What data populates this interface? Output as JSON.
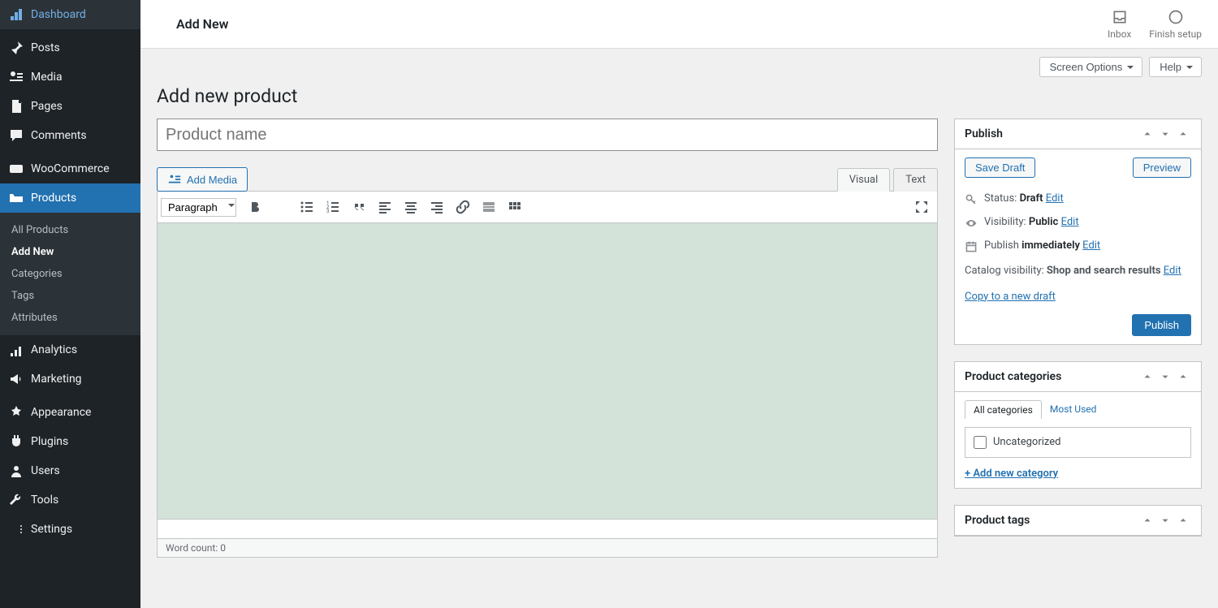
{
  "sidebar": {
    "items": [
      {
        "label": "Dashboard",
        "icon": "dashboard"
      },
      {
        "label": "Posts",
        "icon": "pin"
      },
      {
        "label": "Media",
        "icon": "media"
      },
      {
        "label": "Pages",
        "icon": "pages"
      },
      {
        "label": "Comments",
        "icon": "comments"
      },
      {
        "label": "WooCommerce",
        "icon": "woo"
      },
      {
        "label": "Products",
        "icon": "products",
        "active": true
      },
      {
        "label": "Analytics",
        "icon": "analytics"
      },
      {
        "label": "Marketing",
        "icon": "marketing"
      },
      {
        "label": "Appearance",
        "icon": "appearance"
      },
      {
        "label": "Plugins",
        "icon": "plugins"
      },
      {
        "label": "Users",
        "icon": "users"
      },
      {
        "label": "Tools",
        "icon": "tools"
      },
      {
        "label": "Settings",
        "icon": "settings"
      }
    ],
    "submenu": [
      {
        "label": "All Products"
      },
      {
        "label": "Add New",
        "current": true
      },
      {
        "label": "Categories"
      },
      {
        "label": "Tags"
      },
      {
        "label": "Attributes"
      }
    ]
  },
  "topbar": {
    "title": "Add New",
    "inbox": "Inbox",
    "finish_setup": "Finish setup"
  },
  "page": {
    "screen_options": "Screen Options",
    "help": "Help",
    "title": "Add new product",
    "product_name_placeholder": "Product name"
  },
  "editor": {
    "add_media": "Add Media",
    "tab_visual": "Visual",
    "tab_text": "Text",
    "format": "Paragraph",
    "word_count_label": "Word count:",
    "word_count": "0"
  },
  "publish": {
    "title": "Publish",
    "save_draft": "Save Draft",
    "preview": "Preview",
    "status_label": "Status:",
    "status_value": "Draft",
    "visibility_label": "Visibility:",
    "visibility_value": "Public",
    "publish_label": "Publish",
    "publish_value": "immediately",
    "catalog_label": "Catalog visibility:",
    "catalog_value": "Shop and search results",
    "edit": "Edit",
    "copy_link": "Copy to a new draft",
    "publish_btn": "Publish"
  },
  "categories": {
    "title": "Product categories",
    "tab_all": "All categories",
    "tab_most": "Most Used",
    "uncategorized": "Uncategorized",
    "add_new": "+ Add new category"
  },
  "tags": {
    "title": "Product tags"
  }
}
